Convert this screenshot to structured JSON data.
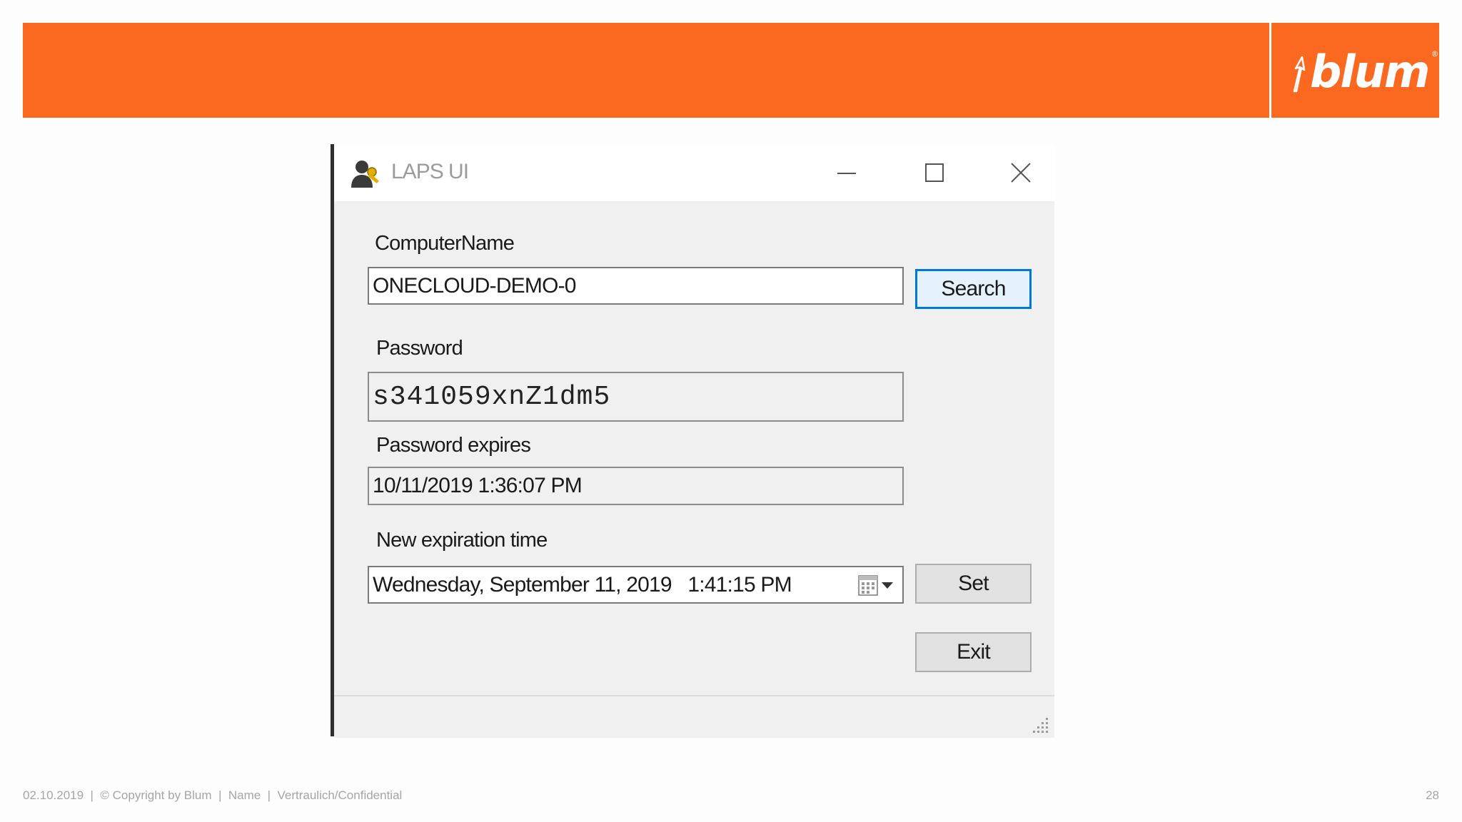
{
  "brand": {
    "logo_text": "blum",
    "registered_mark": "®",
    "banner_color": "#fb6920"
  },
  "window": {
    "title": "LAPS UI",
    "icon": "user-key-icon",
    "controls": [
      "minimize-icon",
      "maximize-icon",
      "close-icon"
    ]
  },
  "form": {
    "computer_name_label": "ComputerName",
    "computer_name_value": "ONECLOUD-DEMO-0",
    "search_button": "Search",
    "password_label": "Password",
    "password_value": "s341059xnZ1dm5",
    "password_expires_label": "Password expires",
    "password_expires_value": "10/11/2019 1:36:07 PM",
    "new_expiration_label": "New expiration time",
    "new_expiration_value": "Wednesday, September 11, 2019   1:41:15 PM",
    "set_button": "Set",
    "exit_button": "Exit"
  },
  "footer": {
    "text": "02.10.2019  |  © Copyright by Blum  |  Name  |  Vertraulich/Confidential",
    "page_number": "28"
  }
}
